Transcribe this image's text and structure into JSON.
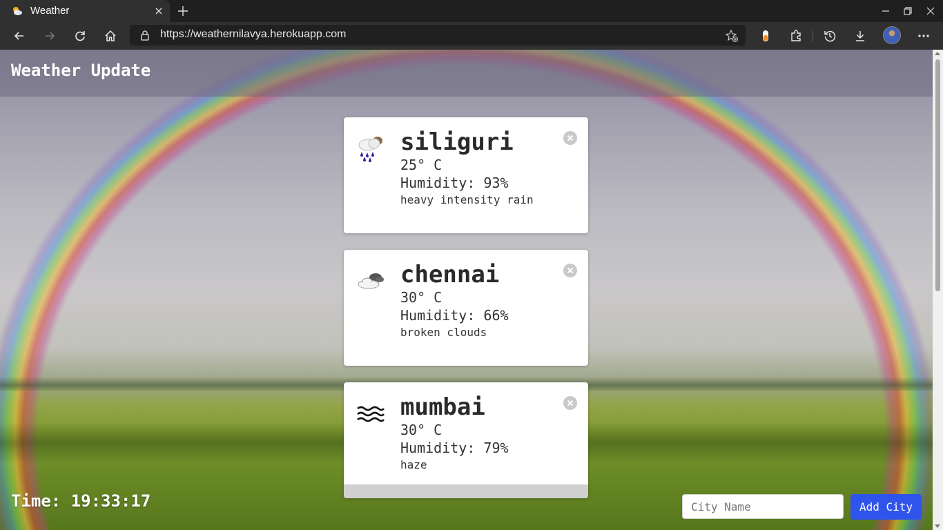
{
  "browser": {
    "tab_title": "Weather",
    "url": "https://weathernilavya.herokuapp.com"
  },
  "page": {
    "header_title": "Weather Update",
    "cards": [
      {
        "city": "siliguri",
        "temp": "25° C",
        "humidity": "Humidity: 93%",
        "description": "heavy intensity rain",
        "icon": "heavy-rain-icon"
      },
      {
        "city": "chennai",
        "temp": "30° C",
        "humidity": "Humidity: 66%",
        "description": "broken clouds",
        "icon": "broken-clouds-icon"
      },
      {
        "city": "mumbai",
        "temp": "30° C",
        "humidity": "Humidity: 79%",
        "description": "haze",
        "icon": "haze-icon"
      }
    ],
    "time": "Time: 19:33:17",
    "input_placeholder": "City Name",
    "add_button_label": "Add City"
  },
  "colors": {
    "accent_button": "#2f54eb",
    "card_bg": "#ffffff",
    "chrome_bg": "#303030"
  }
}
